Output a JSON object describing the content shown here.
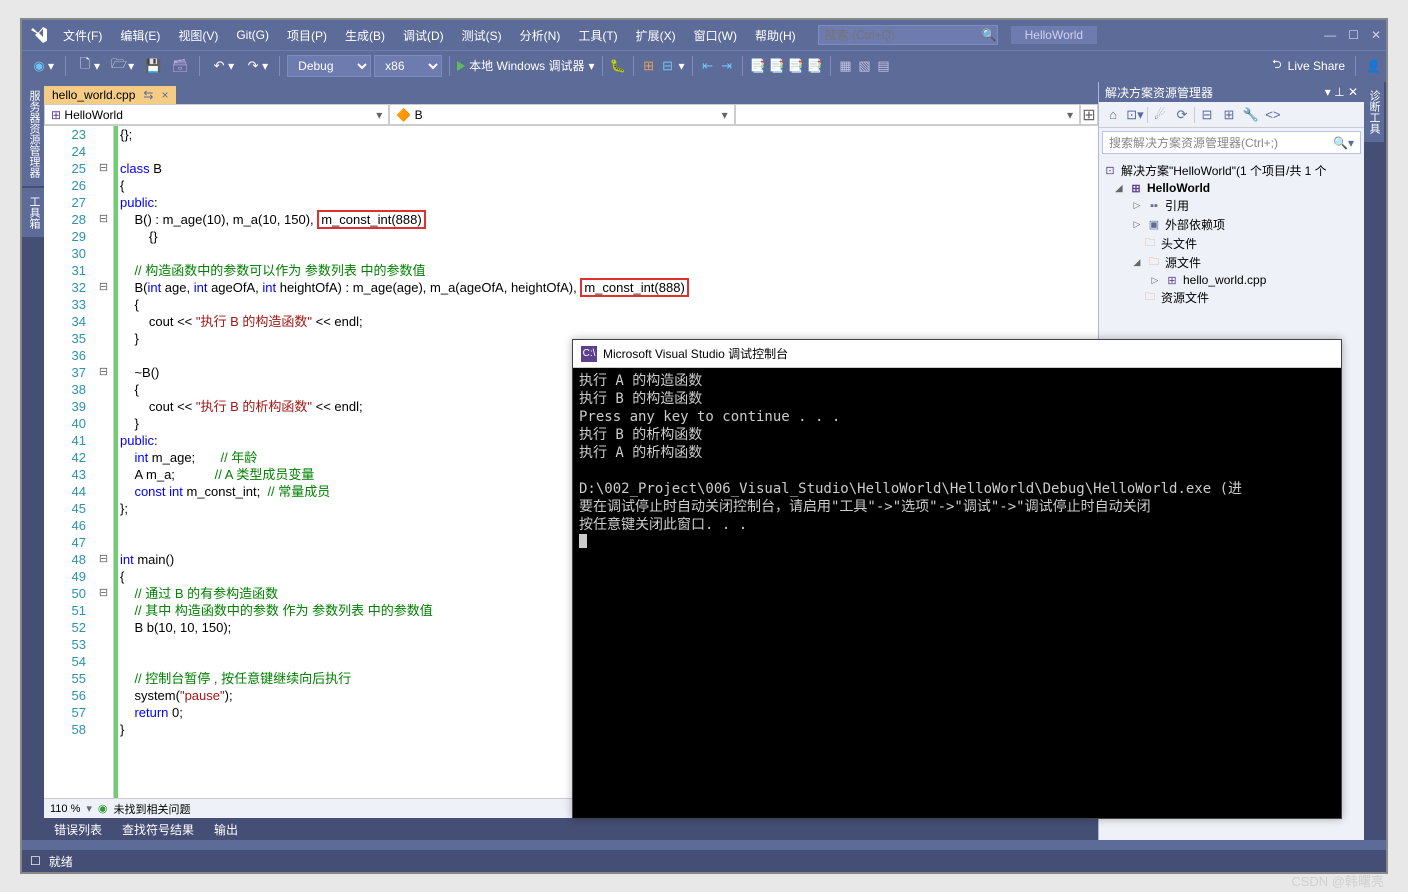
{
  "menu": {
    "items": [
      "文件(F)",
      "编辑(E)",
      "视图(V)",
      "Git(G)",
      "项目(P)",
      "生成(B)",
      "调试(D)",
      "测试(S)",
      "分析(N)",
      "工具(T)",
      "扩展(X)",
      "窗口(W)",
      "帮助(H)"
    ],
    "search_placeholder": "搜索 (Ctrl+Q)",
    "solution": "HelloWorld"
  },
  "toolbar": {
    "config": "Debug",
    "platform": "x86",
    "debugger": "本地 Windows 调试器",
    "live_share": "Live Share"
  },
  "left_tabs": [
    "服务器资源管理器",
    "工具箱"
  ],
  "file_tab": {
    "name": "hello_world.cpp",
    "pin": "⇆",
    "close": "×"
  },
  "nav": {
    "scope": "HelloWorld",
    "class": "B",
    "member": ""
  },
  "code": {
    "lines": [
      {
        "n": 23,
        "t": "{};"
      },
      {
        "n": 24,
        "t": ""
      },
      {
        "n": 25,
        "t": "class B",
        "fold": "⊟"
      },
      {
        "n": 26,
        "t": "{"
      },
      {
        "n": 27,
        "t": "public:"
      },
      {
        "n": 28,
        "t": "    B() : m_age(10), m_a(10, 150), ",
        "box": "m_const_int(888)",
        "fold": "⊟"
      },
      {
        "n": 29,
        "t": "        {}"
      },
      {
        "n": 30,
        "t": ""
      },
      {
        "n": 31,
        "com": "    // 构造函数中的参数可以作为 参数列表 中的参数值"
      },
      {
        "n": 32,
        "t": "    B(int age, int ageOfA, int heightOfA) : m_age(age), m_a(ageOfA, heightOfA), ",
        "box": "m_const_int(888)",
        "fold": "⊟"
      },
      {
        "n": 33,
        "t": "    {"
      },
      {
        "n": 34,
        "t": "        cout << ",
        "str": "\"执行 B 的构造函数\"",
        "t2": " << endl;"
      },
      {
        "n": 35,
        "t": "    }"
      },
      {
        "n": 36,
        "t": ""
      },
      {
        "n": 37,
        "t": "    ~B()",
        "fold": "⊟"
      },
      {
        "n": 38,
        "t": "    {"
      },
      {
        "n": 39,
        "t": "        cout << ",
        "str": "\"执行 B 的析构函数\"",
        "t2": " << endl;"
      },
      {
        "n": 40,
        "t": "    }"
      },
      {
        "n": 41,
        "t": "public:"
      },
      {
        "n": 42,
        "t": "    int m_age;       ",
        "com": "// 年龄"
      },
      {
        "n": 43,
        "t": "    A m_a;           ",
        "com": "// A 类型成员变量"
      },
      {
        "n": 44,
        "t": "    const int m_const_int;  ",
        "com": "// 常量成员"
      },
      {
        "n": 45,
        "t": "};"
      },
      {
        "n": 46,
        "t": ""
      },
      {
        "n": 47,
        "t": ""
      },
      {
        "n": 48,
        "t": "int main()",
        "fold": "⊟"
      },
      {
        "n": 49,
        "t": "{"
      },
      {
        "n": 50,
        "com": "    // 通过 B 的有参构造函数",
        "fold": "⊟"
      },
      {
        "n": 51,
        "com": "    // 其中 构造函数中的参数 作为 参数列表 中的参数值"
      },
      {
        "n": 52,
        "t": "    B b(10, 10, 150);"
      },
      {
        "n": 53,
        "t": ""
      },
      {
        "n": 54,
        "t": ""
      },
      {
        "n": 55,
        "com": "    // 控制台暂停 , 按任意键继续向后执行"
      },
      {
        "n": 56,
        "t": "    system(",
        "str": "\"pause\"",
        "t2": ");"
      },
      {
        "n": 57,
        "t": "    return 0;"
      },
      {
        "n": 58,
        "t": "}"
      }
    ]
  },
  "zoom": {
    "pct": "110 %",
    "issues": "未找到相关问题"
  },
  "bottom_tabs": [
    "错误列表",
    "查找符号结果",
    "输出"
  ],
  "status": {
    "ready": "就绪"
  },
  "solution_explorer": {
    "title": "解决方案资源管理器",
    "search_placeholder": "搜索解决方案资源管理器(Ctrl+;)",
    "root": "解决方案\"HelloWorld\"(1 个项目/共 1 个",
    "project": "HelloWorld",
    "refs": "引用",
    "ext": "外部依赖项",
    "headers": "头文件",
    "sources": "源文件",
    "file": "hello_world.cpp",
    "resources": "资源文件"
  },
  "right_tab": "诊断工具",
  "console": {
    "title": "Microsoft Visual Studio 调试控制台",
    "lines": [
      "执行 A 的构造函数",
      "执行 B 的构造函数",
      "Press any key to continue . . .",
      "执行 B 的析构函数",
      "执行 A 的析构函数",
      "",
      "D:\\002_Project\\006_Visual_Studio\\HelloWorld\\HelloWorld\\Debug\\HelloWorld.exe (进",
      "要在调试停止时自动关闭控制台，请启用\"工具\"->\"选项\"->\"调试\"->\"调试停止时自动关闭",
      "按任意键关闭此窗口. . ."
    ]
  },
  "watermark": "CSDN @韩曙亮"
}
